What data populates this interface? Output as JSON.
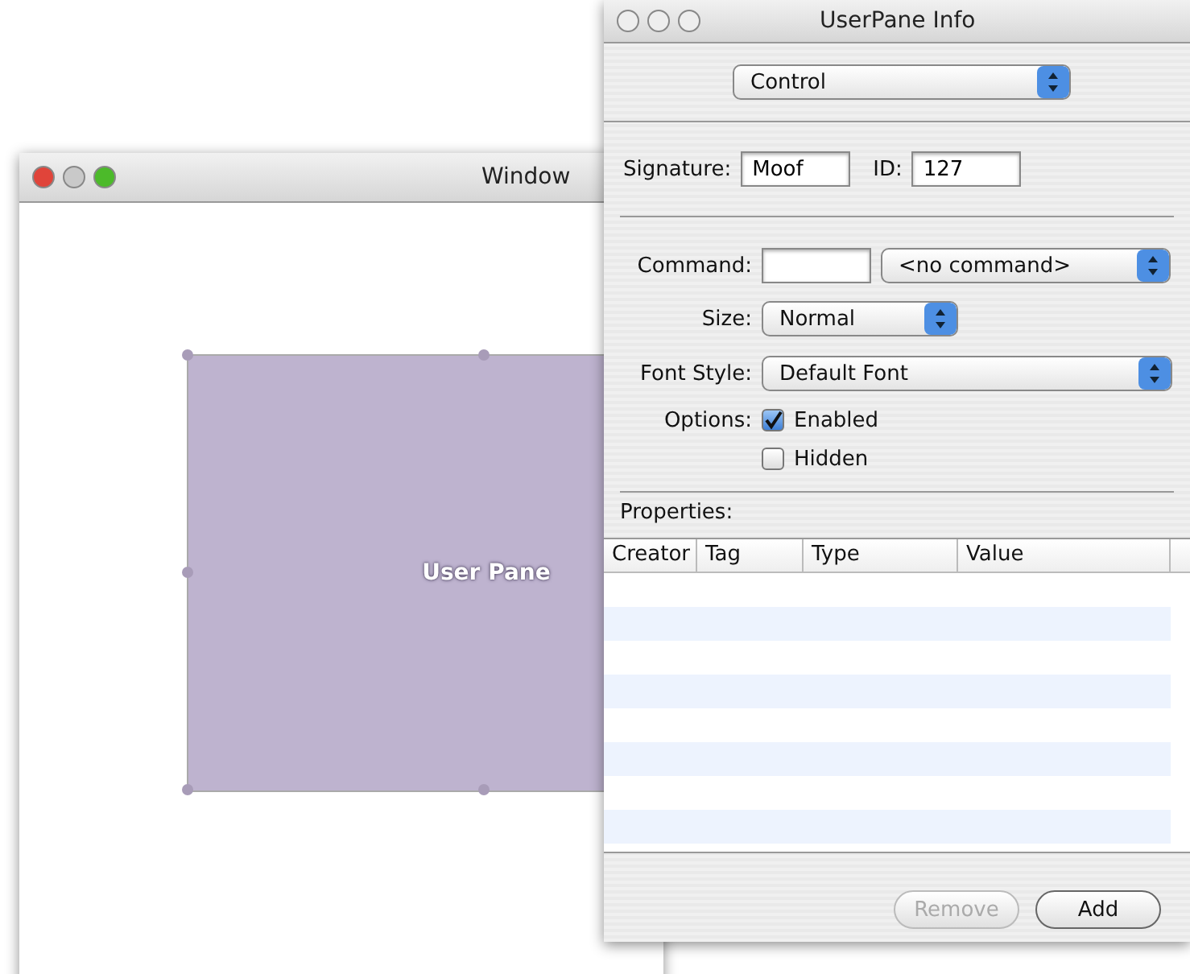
{
  "document_window": {
    "title": "Window",
    "active": true,
    "user_pane": {
      "label": "User Pane"
    }
  },
  "info_window": {
    "title": "UserPane Info",
    "active": false,
    "category_popup": "Control",
    "signature": {
      "label": "Signature:",
      "value": "Moof"
    },
    "id": {
      "label": "ID:",
      "value": "127"
    },
    "command": {
      "label": "Command:",
      "popup": "<no command>"
    },
    "size": {
      "label": "Size:",
      "popup": "Normal"
    },
    "font_style": {
      "label": "Font Style:",
      "popup": "Default Font"
    },
    "options": {
      "label": "Options:",
      "items": [
        {
          "label": "Enabled",
          "checked": true
        },
        {
          "label": "Hidden",
          "checked": false
        }
      ]
    },
    "properties": {
      "label": "Properties:",
      "columns": [
        "Creator",
        "Tag",
        "Type",
        "Value"
      ]
    },
    "buttons": [
      {
        "label": "Remove",
        "disabled": true
      },
      {
        "label": "Add",
        "disabled": false
      }
    ]
  }
}
